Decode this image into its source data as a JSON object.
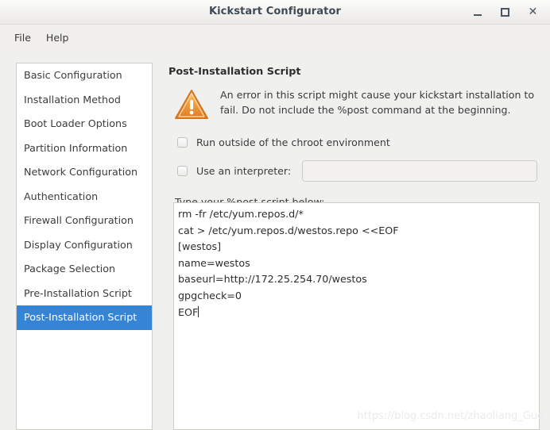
{
  "window": {
    "title": "Kickstart Configurator",
    "controls": {
      "minimize": "minimize-icon",
      "maximize": "maximize-icon",
      "close": "close-icon",
      "close_glyph": "✕"
    }
  },
  "menubar": {
    "items": [
      {
        "label": "File"
      },
      {
        "label": "Help"
      }
    ]
  },
  "sidebar": {
    "items": [
      {
        "label": "Basic Configuration",
        "selected": false
      },
      {
        "label": "Installation Method",
        "selected": false
      },
      {
        "label": "Boot Loader Options",
        "selected": false
      },
      {
        "label": "Partition Information",
        "selected": false
      },
      {
        "label": "Network Configuration",
        "selected": false
      },
      {
        "label": "Authentication",
        "selected": false
      },
      {
        "label": "Firewall Configuration",
        "selected": false
      },
      {
        "label": "Display Configuration",
        "selected": false
      },
      {
        "label": "Package Selection",
        "selected": false
      },
      {
        "label": "Pre-Installation Script",
        "selected": false
      },
      {
        "label": "Post-Installation Script",
        "selected": true
      }
    ],
    "selection_color": "#3584d6"
  },
  "main": {
    "heading": "Post-Installation Script",
    "warning": {
      "icon": "warning-triangle-icon",
      "text": "An error in this script might cause your kickstart installation to fail. Do not include the %post command at the beginning.",
      "color": "#f0903a"
    },
    "checkbox_chroot": {
      "label": "Run outside of the chroot environment",
      "checked": false
    },
    "checkbox_interpreter": {
      "label": "Use an interpreter:",
      "checked": false
    },
    "interpreter_input": {
      "value": "",
      "placeholder": ""
    },
    "script_label": "Type your %post script below:",
    "script_lines": [
      "rm -fr /etc/yum.repos.d/*",
      "cat > /etc/yum.repos.d/westos.repo <<EOF",
      "[westos]",
      "name=westos",
      "baseurl=http://172.25.254.70/westos",
      "gpgcheck=0",
      "EOF"
    ]
  },
  "watermark": {
    "text": "https://blog.csdn.net/zhaoliang_Guo"
  }
}
